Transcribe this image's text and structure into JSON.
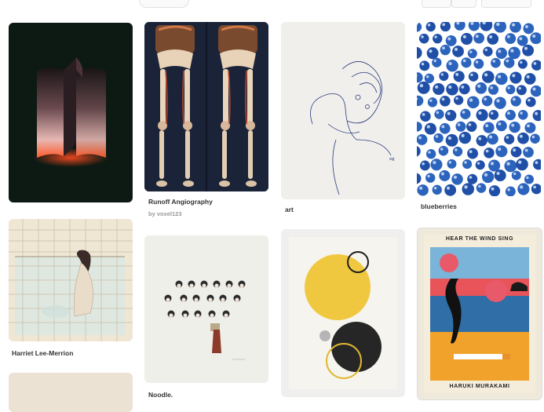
{
  "pins": [
    {
      "name": "pin-abstract-ribbon",
      "caption": "",
      "subcaption": ""
    },
    {
      "name": "pin-runoff-angiography",
      "caption": "Runoff Angiography",
      "subcaption": "by voxel123"
    },
    {
      "name": "pin-art-line-drawing",
      "caption": "art",
      "subcaption": ""
    },
    {
      "name": "pin-blueberries",
      "caption": "blueberries",
      "subcaption": ""
    },
    {
      "name": "pin-harriet-lee-merrion",
      "caption": "Harriet Lee-Merrion",
      "subcaption": ""
    },
    {
      "name": "pin-noodle",
      "caption": "Noodle.",
      "subcaption": ""
    },
    {
      "name": "pin-abstract-circles",
      "caption": "",
      "subcaption": ""
    },
    {
      "name": "pin-hear-the-wind-sing",
      "caption": "",
      "subcaption": ""
    }
  ],
  "book": {
    "title": "HEAR THE WIND SING",
    "author": "HARUKI MURAKAMI"
  }
}
